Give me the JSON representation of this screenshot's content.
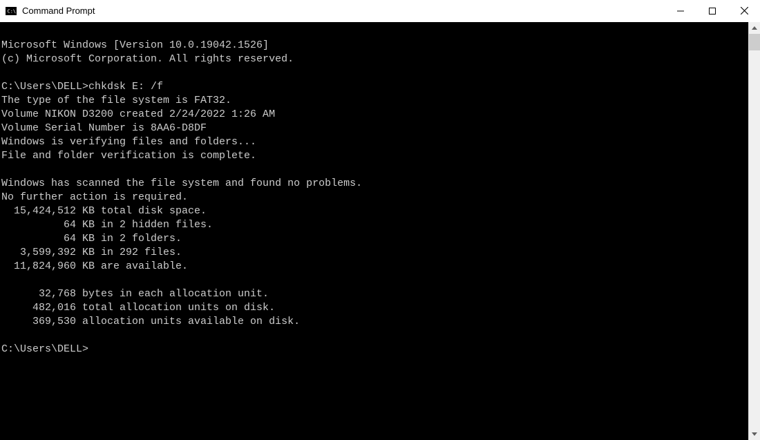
{
  "titlebar": {
    "title": "Command Prompt"
  },
  "console": {
    "version_line": "Microsoft Windows [Version 10.0.19042.1526]",
    "copyright_line": "(c) Microsoft Corporation. All rights reserved.",
    "blank": "",
    "prompt1_path": "C:\\Users\\DELL>",
    "prompt1_cmd": "chkdsk E: /f",
    "fs_type": "The type of the file system is FAT32.",
    "vol_created": "Volume NIKON D3200 created 2/24/2022 1:26 AM",
    "vol_serial": "Volume Serial Number is 8AA6-D8DF",
    "verify_msg": "Windows is verifying files and folders...",
    "verify_done": "File and folder verification is complete.",
    "scan_result": "Windows has scanned the file system and found no problems.",
    "no_action": "No further action is required.",
    "total_space": "  15,424,512 KB total disk space.",
    "hidden_files": "          64 KB in 2 hidden files.",
    "folders": "          64 KB in 2 folders.",
    "files": "   3,599,392 KB in 292 files.",
    "available": "  11,824,960 KB are available.",
    "alloc_unit": "      32,768 bytes in each allocation unit.",
    "total_units": "     482,016 total allocation units on disk.",
    "avail_units": "     369,530 allocation units available on disk.",
    "prompt2_path": "C:\\Users\\DELL>"
  }
}
